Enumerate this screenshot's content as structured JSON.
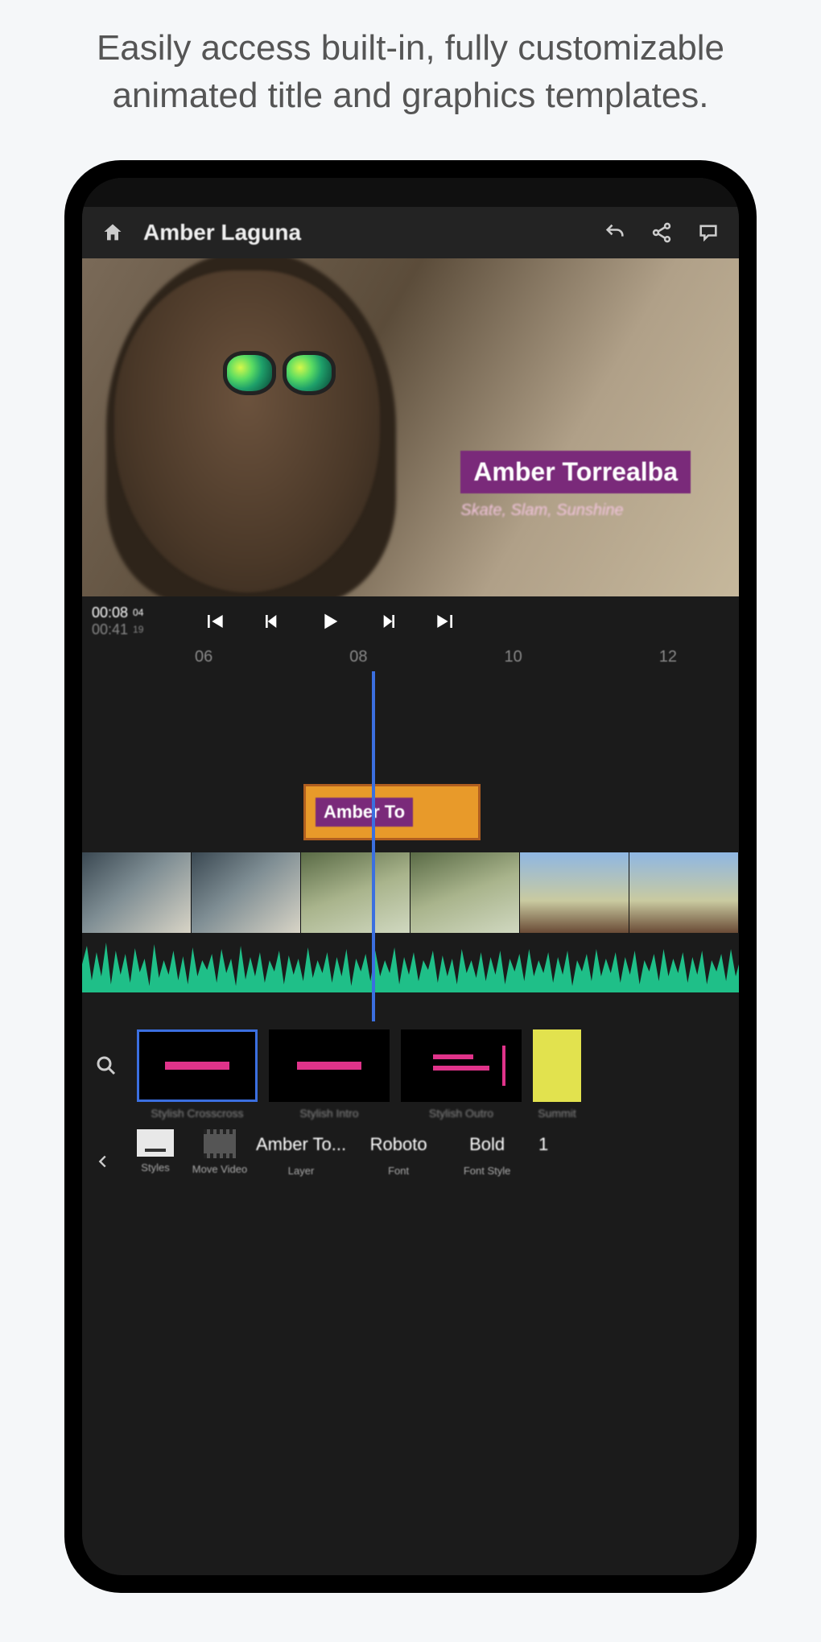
{
  "marketing": "Easily access built-in, fully customizable animated title and graphics templates.",
  "header": {
    "project_name": "Amber Laguna"
  },
  "preview": {
    "title_text": "Amber Torrealba",
    "subtitle_text": "Skate, Slam, Sunshine"
  },
  "transport": {
    "current_time": "00:08",
    "current_frames": "04",
    "total_time": "00:41",
    "total_frames": "19"
  },
  "ruler_ticks": [
    "06",
    "08",
    "10",
    "12"
  ],
  "title_clip_label": "Amber To",
  "templates": [
    {
      "label": "Stylish Crosscross",
      "selected": true
    },
    {
      "label": "Stylish Intro",
      "selected": false
    },
    {
      "label": "Stylish Outro",
      "selected": false
    },
    {
      "label": "Summit",
      "selected": false
    }
  ],
  "bottom_bar": {
    "back_icon": "chevron-left",
    "items": [
      {
        "value": "",
        "label": "Styles",
        "kind": "styles"
      },
      {
        "value": "",
        "label": "Move\nVideo",
        "kind": "movie"
      },
      {
        "value": "Amber To...",
        "label": "Layer",
        "kind": "text"
      },
      {
        "value": "Roboto",
        "label": "Font",
        "kind": "text"
      },
      {
        "value": "Bold",
        "label": "Font Style",
        "kind": "text"
      },
      {
        "value": "1",
        "label": "",
        "kind": "text"
      }
    ]
  }
}
